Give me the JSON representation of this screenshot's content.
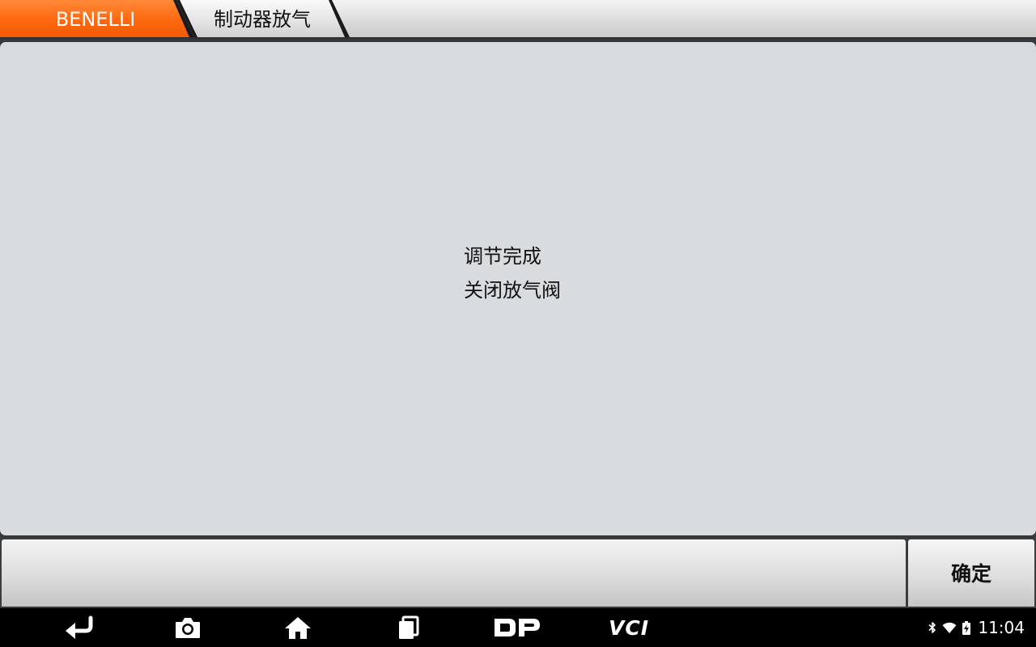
{
  "breadcrumb": {
    "brand": "BENELLI",
    "page": "制动器放气",
    "brand_color": "#ff6a12"
  },
  "content": {
    "lines": [
      "调节完成",
      "关闭放气阀"
    ]
  },
  "actions": {
    "confirm_label": "确定"
  },
  "navbar": {
    "icons": [
      "back-icon",
      "camera-icon",
      "home-icon",
      "recent-apps-icon",
      "dp-icon",
      "vci-icon"
    ],
    "vci_label": "VCI"
  },
  "status": {
    "icons": [
      "bluetooth-icon",
      "wifi-icon",
      "battery-charging-icon"
    ],
    "time": "11:04"
  }
}
